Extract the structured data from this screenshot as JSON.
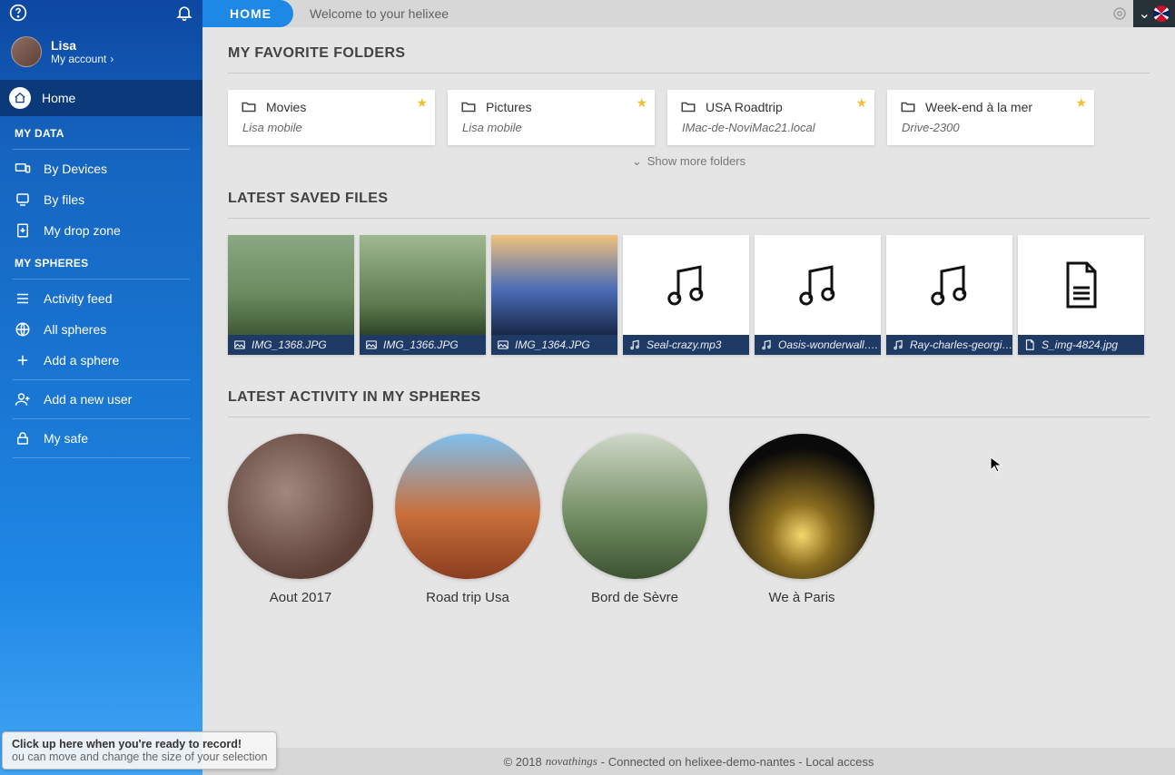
{
  "header": {
    "home_tab": "HOME",
    "welcome": "Welcome to your helixee"
  },
  "user": {
    "name": "Lisa",
    "account_label": "My account"
  },
  "sidebar": {
    "home": "Home",
    "section_data": "MY DATA",
    "by_devices": "By Devices",
    "by_files": "By files",
    "drop_zone": "My drop zone",
    "section_spheres": "MY SPHERES",
    "activity_feed": "Activity feed",
    "all_spheres": "All spheres",
    "add_sphere": "Add a sphere",
    "add_user": "Add a new user",
    "my_safe": "My safe"
  },
  "sections": {
    "favorites": "MY FAVORITE FOLDERS",
    "latest_files": "LATEST SAVED FILES",
    "latest_activity": "LATEST ACTIVITY IN MY SPHERES",
    "show_more": "Show more folders"
  },
  "folders": [
    {
      "name": "Movies",
      "location": "Lisa mobile"
    },
    {
      "name": "Pictures",
      "location": "Lisa mobile"
    },
    {
      "name": "USA Roadtrip",
      "location": "IMac-de-NoviMac21.local"
    },
    {
      "name": "Week-end à la mer",
      "location": "Drive-2300"
    }
  ],
  "files": [
    {
      "name": "IMG_1368.JPG",
      "type": "image"
    },
    {
      "name": "IMG_1366.JPG",
      "type": "image"
    },
    {
      "name": "IMG_1364.JPG",
      "type": "image"
    },
    {
      "name": "Seal-crazy.mp3",
      "type": "audio"
    },
    {
      "name": "Oasis-wonderwall….",
      "type": "audio"
    },
    {
      "name": "Ray-charles-georgi…",
      "type": "audio"
    },
    {
      "name": "S_img-4824.jpg",
      "type": "doc"
    }
  ],
  "spheres": [
    {
      "name": "Aout 2017"
    },
    {
      "name": "Road trip Usa"
    },
    {
      "name": "Bord de Sèvre"
    },
    {
      "name": "We à Paris"
    }
  ],
  "footer": {
    "copyright": "© 2018",
    "brand": "novathings",
    "status": "- Connected on helixee-demo-nantes - Local access"
  },
  "recorder": {
    "line1": "Click up here when you're ready to record!",
    "line2": "ou can move and change the size of your selection"
  }
}
